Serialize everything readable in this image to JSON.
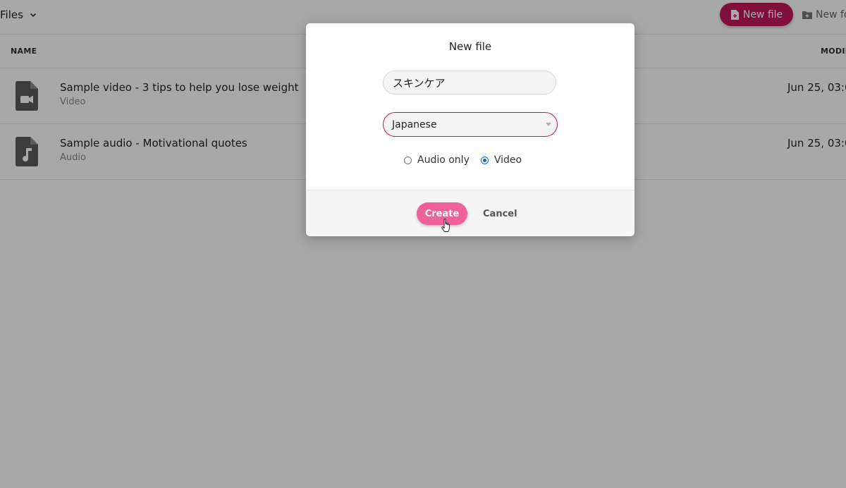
{
  "header": {
    "breadcrumb": "Files",
    "new_file_label": "New file",
    "new_folder_label": "New fo"
  },
  "table": {
    "columns": {
      "name": "NAME",
      "modified": "MODIF"
    },
    "rows": [
      {
        "title": "Sample video - 3 tips to help you lose weight",
        "type": "Video",
        "modified": "Jun 25, 03:0",
        "icon": "video-file-icon"
      },
      {
        "title": "Sample audio - Motivational quotes",
        "type": "Audio",
        "modified": "Jun 25, 03:0",
        "icon": "audio-file-icon"
      }
    ]
  },
  "dialog": {
    "title": "New file",
    "name_value": "スキンケア",
    "language_selected": "Japanese",
    "media_options": [
      {
        "label": "Audio only",
        "checked": false
      },
      {
        "label": "Video",
        "checked": true
      }
    ],
    "create_label": "Create",
    "cancel_label": "Cancel"
  },
  "colors": {
    "primary": "#c2185b",
    "create_button": "#f0609a",
    "radio_checked": "#1565c0",
    "overlay": "rgba(0,0,0,0.34)"
  }
}
